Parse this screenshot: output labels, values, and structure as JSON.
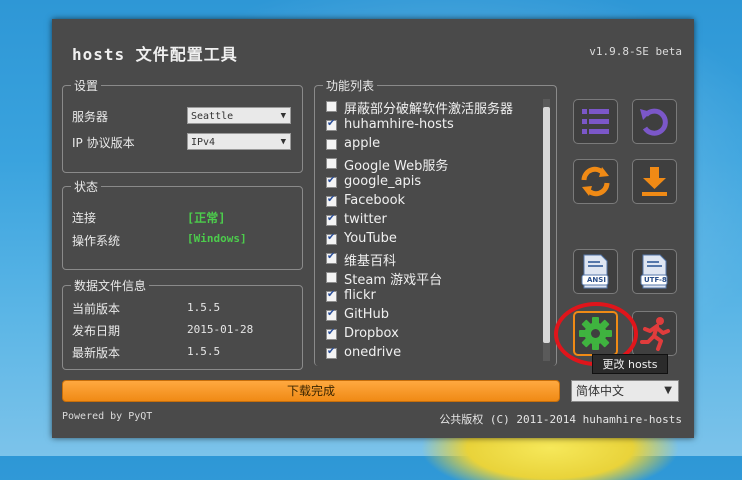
{
  "app": {
    "title": "hosts 文件配置工具",
    "version": "v1.9.8-SE beta"
  },
  "settings": {
    "legend": "设置",
    "server_label": "服务器",
    "server_value": "Seattle",
    "ip_label": "IP 协议版本",
    "ip_value": "IPv4"
  },
  "status": {
    "legend": "状态",
    "connection_label": "连接",
    "connection_value": "[正常]",
    "os_label": "操作系统",
    "os_value": "[Windows]"
  },
  "datafile": {
    "legend": "数据文件信息",
    "current_label": "当前版本",
    "current_value": "1.5.5",
    "date_label": "发布日期",
    "date_value": "2015-01-28",
    "latest_label": "最新版本",
    "latest_value": "1.5.5"
  },
  "functions": {
    "legend": "功能列表",
    "items": [
      {
        "label": "屏蔽部分破解软件激活服务器",
        "checked": false
      },
      {
        "label": "huhamhire-hosts",
        "checked": true
      },
      {
        "label": "apple",
        "checked": false
      },
      {
        "label": "Google Web服务",
        "checked": false
      },
      {
        "label": "google_apis",
        "checked": true
      },
      {
        "label": "Facebook",
        "checked": true
      },
      {
        "label": "twitter",
        "checked": true
      },
      {
        "label": "YouTube",
        "checked": true
      },
      {
        "label": "维基百科",
        "checked": true
      },
      {
        "label": "Steam 游戏平台",
        "checked": false
      },
      {
        "label": "flickr",
        "checked": true
      },
      {
        "label": "GitHub",
        "checked": true
      },
      {
        "label": "Dropbox",
        "checked": true
      },
      {
        "label": "onedrive",
        "checked": true
      }
    ]
  },
  "tools": {
    "ansi_label": "ANSI",
    "utf8_label": "UTF-8",
    "tooltip": "更改 hosts"
  },
  "bottom": {
    "progress_text": "下载完成",
    "language_value": "简体中文",
    "powered_by": "Powered by PyQT",
    "copyright": "公共版权 (C) 2011-2014 huhamhire-hosts"
  },
  "colors": {
    "window_bg": "#4a4a4a",
    "accent_purple": "#7b57c8",
    "accent_orange": "#f08a15",
    "accent_green": "#3fb33f",
    "status_green": "#4ccc4c",
    "highlight_red": "#e0151b"
  }
}
